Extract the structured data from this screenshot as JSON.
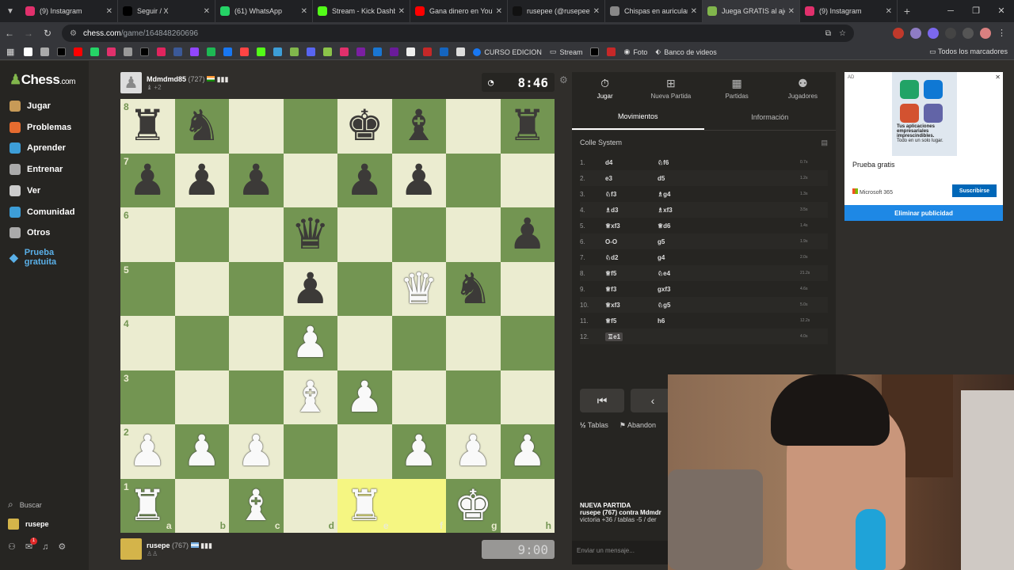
{
  "browser": {
    "tabs": [
      {
        "title": "(9) Instagram",
        "color": "#e1306c"
      },
      {
        "title": "Seguir / X",
        "color": "#000000"
      },
      {
        "title": "(61) WhatsApp",
        "color": "#25d366"
      },
      {
        "title": "Stream - Kick Dashbo",
        "color": "#53fc18"
      },
      {
        "title": "Gana dinero en YouT",
        "color": "#ff0000"
      },
      {
        "title": "rusepee (@rusepee)",
        "color": "#111111"
      },
      {
        "title": "Chispas en auricular",
        "color": "#888888"
      },
      {
        "title": "Juega GRATIS al ajed",
        "color": "#81b64c"
      },
      {
        "title": "(9) Instagram",
        "color": "#e1306c"
      }
    ],
    "new_tab": "+",
    "url_host": "chess.com",
    "url_path": "/game/164848260696",
    "bookmarks": [
      "CURSO EDICION",
      "Stream",
      "Foto",
      "Banco de videos"
    ],
    "all_bookmarks": "Todos los marcadores"
  },
  "sidebar": {
    "logo": "Chess",
    "logo_suffix": ".com",
    "items": [
      {
        "label": "Jugar",
        "color": "#c79a57"
      },
      {
        "label": "Problemas",
        "color": "#e56b2f"
      },
      {
        "label": "Aprender",
        "color": "#3d9ed8"
      },
      {
        "label": "Entrenar",
        "color": "#aaaaaa"
      },
      {
        "label": "Ver",
        "color": "#cccccc"
      },
      {
        "label": "Comunidad",
        "color": "#3d9ed8"
      },
      {
        "label": "Otros",
        "color": "#aaaaaa"
      }
    ],
    "trial": "Prueba gratuita",
    "search": "Buscar",
    "username": "rusepe",
    "notification_count": "1"
  },
  "top_player": {
    "name": "Mdmdmd85",
    "rating": "(727)",
    "extra": "+2",
    "clock": "8:46"
  },
  "bottom_player": {
    "name": "rusepe",
    "rating": "(767)",
    "clock": "9:00"
  },
  "board": {
    "rows": [
      [
        "br",
        "bn",
        "",
        "",
        "bk",
        "bb",
        "",
        "br"
      ],
      [
        "bp",
        "bp",
        "bp",
        "",
        "bp",
        "bp",
        "",
        ""
      ],
      [
        "",
        "",
        "",
        "bq",
        "",
        "",
        "",
        "bp"
      ],
      [
        "",
        "",
        "",
        "bp",
        "",
        "wq",
        "bn",
        ""
      ],
      [
        "",
        "",
        "",
        "wp",
        "",
        "",
        "",
        ""
      ],
      [
        "",
        "",
        "",
        "wb",
        "wp",
        "",
        "",
        ""
      ],
      [
        "wp",
        "wp",
        "wp",
        "",
        "",
        "wp",
        "wp",
        "wp"
      ],
      [
        "wr",
        "",
        "wb",
        "",
        "wr",
        "",
        "wk",
        ""
      ]
    ],
    "ranks": [
      "8",
      "7",
      "6",
      "5",
      "4",
      "3",
      "2",
      "1"
    ],
    "files": [
      "a",
      "b",
      "c",
      "d",
      "e",
      "f",
      "g",
      "h"
    ]
  },
  "panel": {
    "tabs": [
      "Jugar",
      "Nueva Partida",
      "Partidas",
      "Jugadores"
    ],
    "subtabs": [
      "Movimientos",
      "Información"
    ],
    "opening": "Colle System",
    "moves": [
      {
        "n": "1.",
        "w": "d4",
        "b": "♘f6",
        "t": "0.7s"
      },
      {
        "n": "2.",
        "w": "e3",
        "b": "d5",
        "t": "1.2s"
      },
      {
        "n": "3.",
        "w": "♘f3",
        "b": "♗g4",
        "t": "1.3s"
      },
      {
        "n": "4.",
        "w": "♗d3",
        "b": "♗xf3",
        "t": "3.5s"
      },
      {
        "n": "5.",
        "w": "♕xf3",
        "b": "♕d6",
        "t": "1.4s"
      },
      {
        "n": "6.",
        "w": "O-O",
        "b": "g5",
        "t": "1.9s"
      },
      {
        "n": "7.",
        "w": "♘d2",
        "b": "g4",
        "t": "2.0s"
      },
      {
        "n": "8.",
        "w": "♕f5",
        "b": "♘e4",
        "t": "21.2s"
      },
      {
        "n": "9.",
        "w": "♕f3",
        "b": "gxf3",
        "t": "4.6s"
      },
      {
        "n": "10.",
        "w": "♕xf3",
        "b": "♘g5",
        "t": "5.0s"
      },
      {
        "n": "11.",
        "w": "♕f5",
        "b": "h6",
        "t": "12.2s"
      },
      {
        "n": "12.",
        "w": "♖e1",
        "b": "",
        "t": "4.0s"
      }
    ],
    "draw": "Tablas",
    "resign": "Abandon",
    "newgame_title": "NUEVA PARTIDA",
    "newgame_line1": "rusepe (767) contra Mdmdr",
    "newgame_line2": "victoria +36 / tablas -5 / der",
    "chat_placeholder": "Enviar un mensaje..."
  },
  "ad": {
    "tag": "AD",
    "image_text": "Tus aplicaciones empresariales imprescindibles.",
    "image_subtext": "Todo en un solo lugar.",
    "title": "Prueba gratis",
    "brand": "Microsoft 365",
    "button": "Suscribirse",
    "remove": "Eliminar publicidad"
  }
}
